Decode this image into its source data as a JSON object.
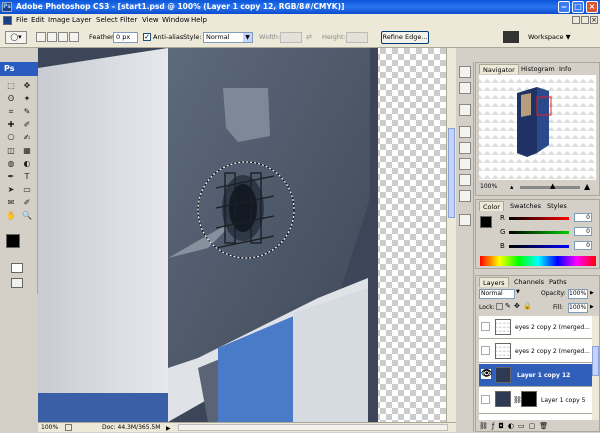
{
  "window": {
    "title": "Adobe Photoshop CS3 - [start1.psd @ 100% (Layer 1 copy 12, RGB/8#/CMYK)]",
    "app_badge": "Ps"
  },
  "menu": [
    "File",
    "Edit",
    "Image",
    "Layer",
    "Select",
    "Filter",
    "View",
    "Window",
    "Help"
  ],
  "options": {
    "feather_label": "Feather:",
    "feather_value": "0 px",
    "antialias_label": "Anti-alias",
    "style_label": "Style:",
    "style_value": "Normal",
    "width_label": "Width:",
    "height_label": "Height:",
    "refine_edge": "Refine Edge...",
    "workspace": "Workspace ▼"
  },
  "toolbox": {
    "badge": "Ps",
    "tools": [
      "marquee-tool",
      "move-tool",
      "lasso-tool",
      "magic-wand-tool",
      "crop-tool",
      "slice-tool",
      "healing-brush-tool",
      "brush-tool",
      "clone-stamp-tool",
      "history-brush-tool",
      "eraser-tool",
      "gradient-tool",
      "blur-tool",
      "dodge-tool",
      "pen-tool",
      "type-tool",
      "path-selection-tool",
      "shape-tool",
      "notes-tool",
      "eyedropper-tool",
      "hand-tool",
      "zoom-tool"
    ],
    "tool_glyphs": [
      "⬚",
      "✥",
      "ʘ",
      "✦",
      "⌗",
      "✎",
      "✚",
      "✐",
      "⎔",
      "✍",
      "◫",
      "▦",
      "◍",
      "◐",
      "✒",
      "T",
      "➤",
      "▭",
      "✉",
      "✐",
      "✋",
      "🔍"
    ]
  },
  "status": {
    "zoom": "100%",
    "doc": "Doc: 44.3M/365.5M"
  },
  "navigator": {
    "tabs": [
      "Navigator",
      "Histogram",
      "Info"
    ],
    "zoom": "100%"
  },
  "color": {
    "tabs": [
      "Color",
      "Swatches",
      "Styles"
    ],
    "channels": [
      {
        "label": "R",
        "value": "0",
        "color": "#d00000"
      },
      {
        "label": "G",
        "value": "0",
        "color": "#00a000"
      },
      {
        "label": "B",
        "value": "0",
        "color": "#0000d0"
      }
    ]
  },
  "layers": {
    "tabs": [
      "Layers",
      "Channels",
      "Paths"
    ],
    "blend_mode": "Normal",
    "opacity_label": "Opacity:",
    "opacity_value": "100%",
    "lock_label": "Lock:",
    "fill_label": "Fill:",
    "fill_value": "100%",
    "rows": [
      {
        "name": "eyes 2 copy 2 (merged..."
      },
      {
        "name": "eyes 2 copy 2 (merged..."
      },
      {
        "name": "Layer 1 copy 12"
      },
      {
        "name": "Layer 1 copy 5"
      }
    ]
  },
  "colors": {
    "accent": "#2f5fb8",
    "titlebar": "#0a55d8",
    "panel": "#d4d0c8"
  }
}
